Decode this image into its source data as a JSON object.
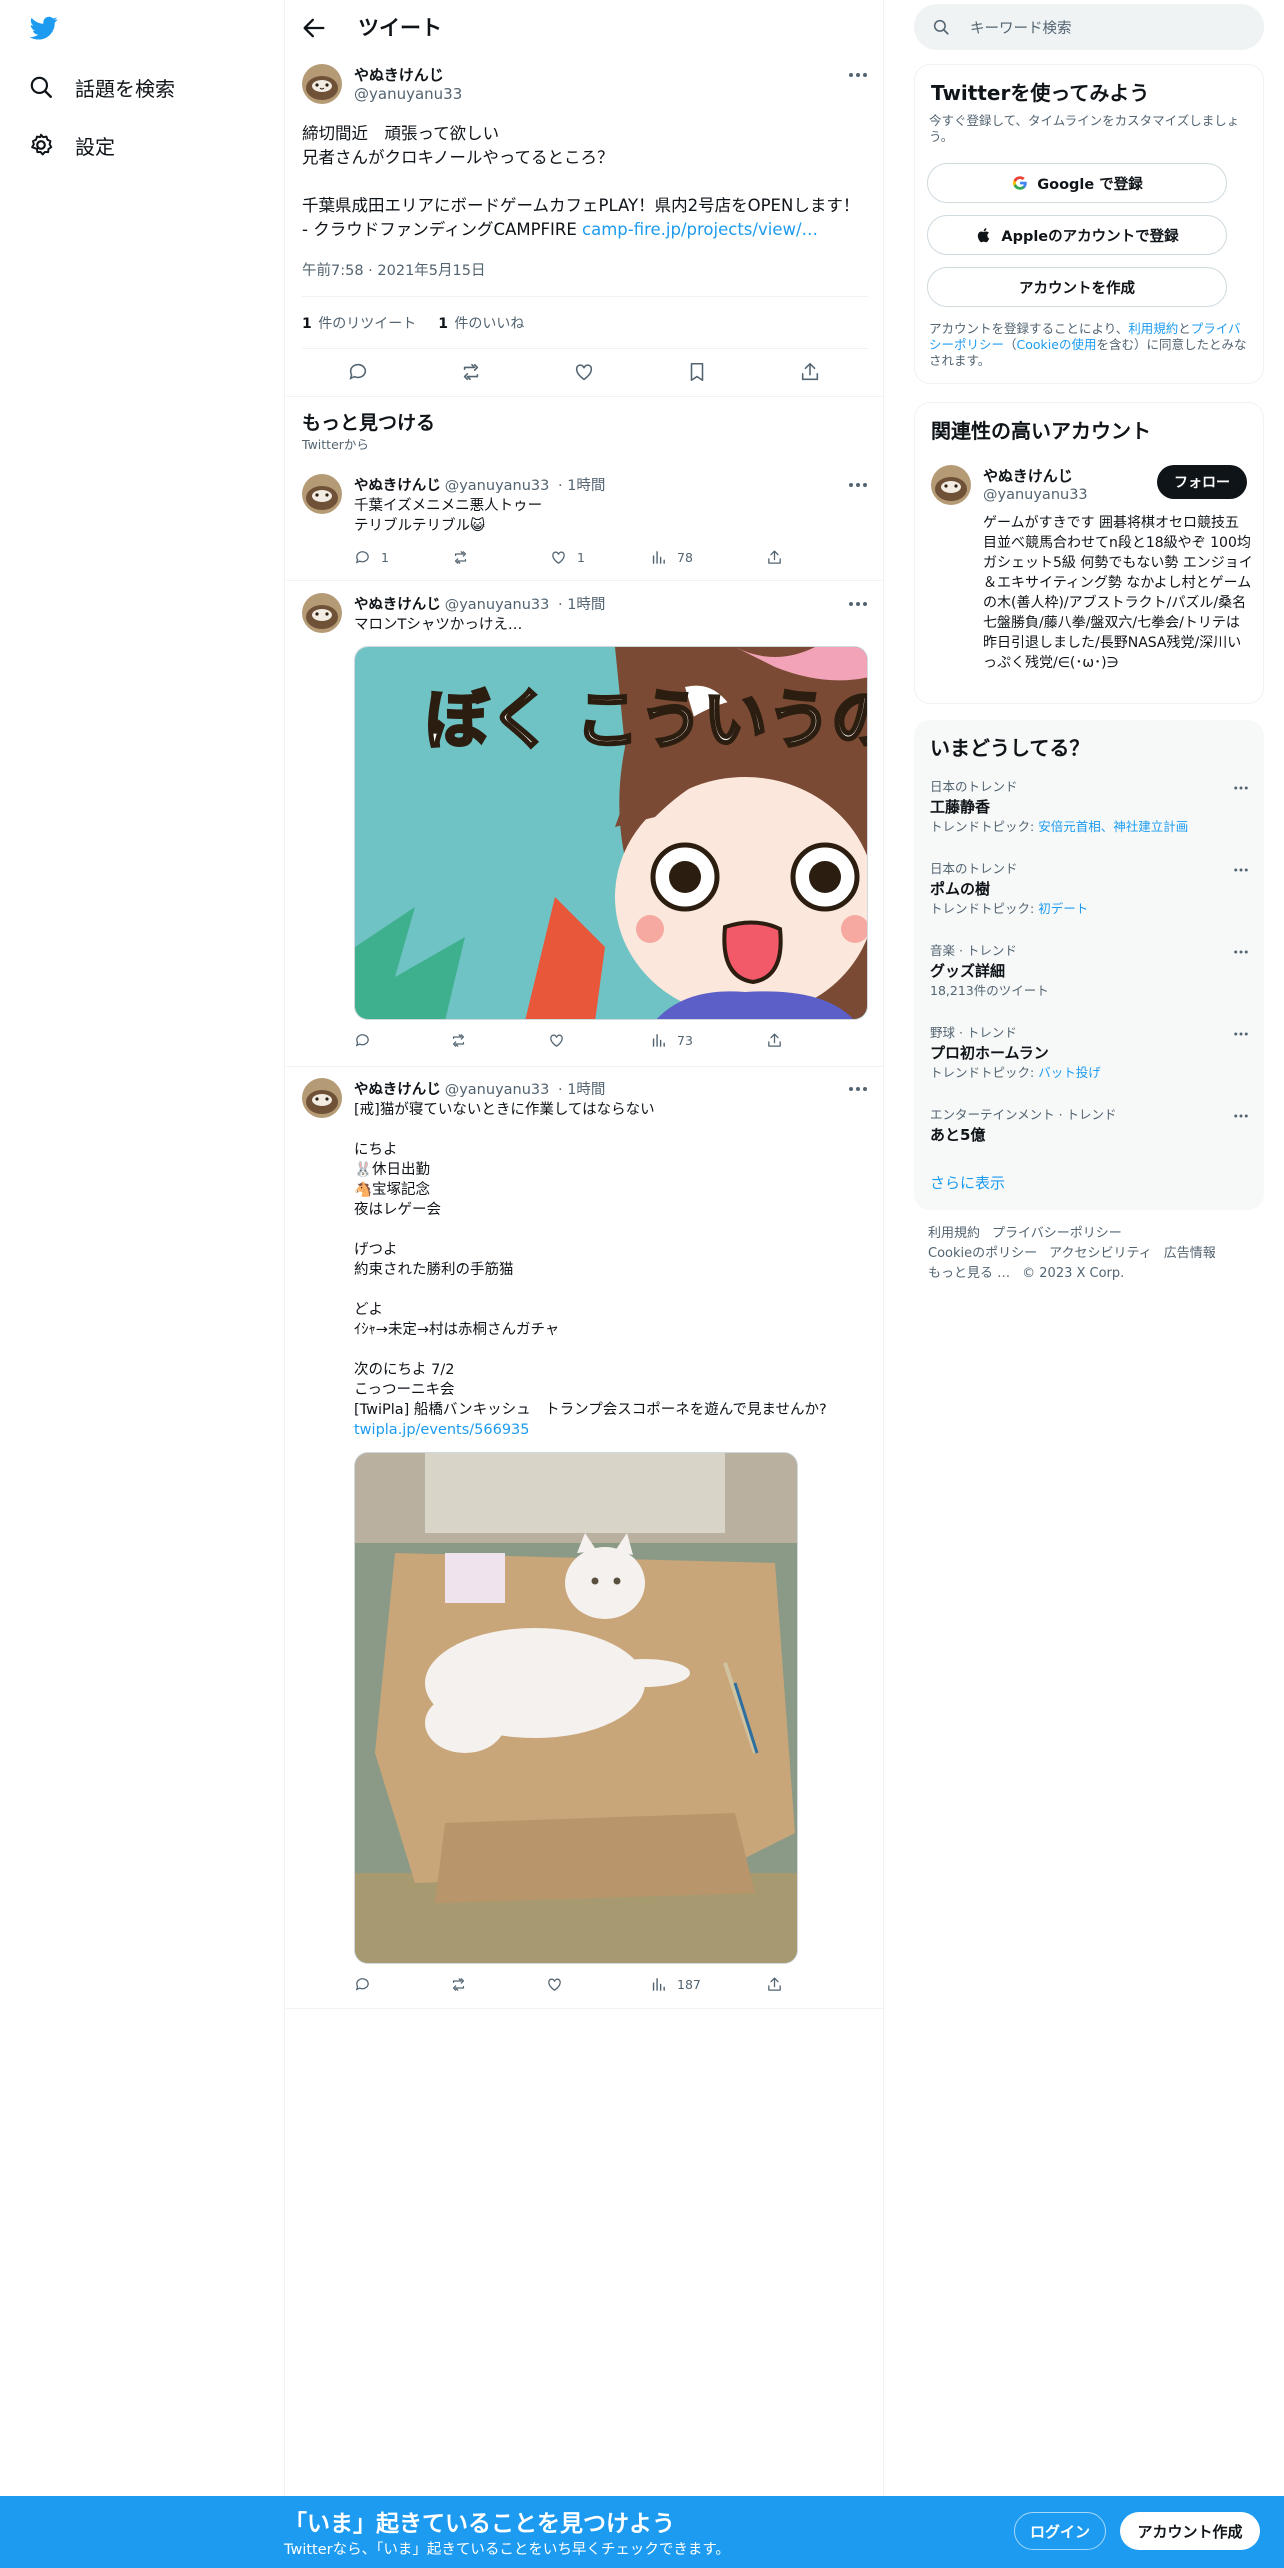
{
  "nav": {
    "explore_label": "話題を検索",
    "settings_label": "設定"
  },
  "header": {
    "title": "ツイート"
  },
  "focused_tweet": {
    "name": "やぬきけんじ",
    "handle": "@yanuyanu33",
    "text_line1": "締切間近　頑張って欲しい",
    "text_line2": "兄者さんがクロキノールやってるところ？",
    "text_line3": "千葉県成田エリアにボードゲームカフェPLAY！県内2号店をOPENします！ - クラウドファンディングCAMPFIRE ",
    "link": "camp-fire.jp/projects/view/…",
    "time": "午前7:58 · 2021年5月15日",
    "retweet_count": "1",
    "retweet_label": "件のリツイート",
    "like_count": "1",
    "like_label": "件のいいね"
  },
  "discover": {
    "title": "もっと見つける",
    "subtitle": "Twitterから"
  },
  "tweets": [
    {
      "name": "やぬきけんじ",
      "handle": "@yanuyanu33",
      "time": "· 1時間",
      "line1": "千葉イズメニメニ悪人トゥー",
      "line2": "テリブルテリブル😺",
      "replies": "1",
      "likes": "1",
      "views": "78"
    },
    {
      "name": "やぬきけんじ",
      "handle": "@yanuyanu33",
      "time": "· 1時間",
      "line1": "マロンTシャツかっけえ…",
      "image_text": "ぼく こういうの すき",
      "views": "73"
    },
    {
      "name": "やぬきけんじ",
      "handle": "@yanuyanu33",
      "time": "· 1時間",
      "body": "[戒]猫が寝ていないときに作業してはならない\n\nにちよ\n🐰休日出勤\n🐴宝塚記念\n夜はレゲー会\n\nげつよ\n約束された勝利の手筋猫\n\nどよ\nｲｼｬ→未定→村は赤桐さんガチャ\n\n次のにちよ 7/2\nこっつーニキ会\n[TwiPla] 船橋バンキッシュ　トランプ会スコポーネを遊んで見ませんか?",
      "link": "twipla.jp/events/566935",
      "views": "187"
    }
  ],
  "search": {
    "placeholder": "キーワード検索"
  },
  "signup_card": {
    "title": "Twitterを使ってみよう",
    "subtitle": "今すぐ登録して、タイムラインをカスタマイズしましょう。",
    "google_label": "Google で登録",
    "apple_label": "Appleのアカウントで登録",
    "create_label": "アカウントを作成",
    "legal_pre": "アカウントを登録することにより、",
    "legal_terms": "利用規約",
    "legal_and": "と",
    "legal_privacy": "プライバシーポリシー",
    "legal_mid": "（",
    "legal_cookie": "Cookieの使用",
    "legal_post": "を含む）に同意したとみなされます。"
  },
  "related": {
    "title": "関連性の高いアカウント",
    "name": "やぬきけんじ",
    "handle": "@yanuyanu33",
    "follow_label": "フォロー",
    "bio": "ゲームがすきです 囲碁将棋オセロ競技五目並べ競馬合わせてn段と18級やぞ 100均ガシェット5級 何勢でもない勢 エンジョイ＆エキサイティング勢 なかよし村とゲームの木(善人枠)/アブストラクト/パズル/桑名七盤勝負/藤八拳/盤双六/七拳会/トリテは昨日引退しました/長野NASA残党/深川いっぷく残党/∈(･ω･)∋"
  },
  "trends": {
    "title": "いまどうしてる？",
    "items": [
      {
        "category": "日本のトレンド",
        "name": "工藤静香",
        "topic_label": "トレンドトピック: ",
        "topics": "安倍元首相、神社建立計画"
      },
      {
        "category": "日本のトレンド",
        "name": "ポムの樹",
        "topic_label": "トレンドトピック: ",
        "topics": "初デート"
      },
      {
        "category": "音楽 · トレンド",
        "name": "グッズ詳細",
        "count": "18,213件のツイート"
      },
      {
        "category": "野球 · トレンド",
        "name": "プロ初ホームラン",
        "topic_label": "トレンドトピック: ",
        "topics": "バット投げ"
      },
      {
        "category": "エンターテインメント · トレンド",
        "name": "あと5億"
      }
    ],
    "show_more": "さらに表示"
  },
  "footer": {
    "links": [
      "利用規約",
      "プライバシーポリシー",
      "Cookieのポリシー",
      "アクセシビリティ",
      "広告情報",
      "もっと見る …"
    ],
    "copyright": "© 2023 X Corp."
  },
  "bottom": {
    "title": "「いま」起きていることを見つけよう",
    "subtitle": "Twitterなら、「いま」起きていることをいち早くチェックできます。",
    "login": "ログイン",
    "signup": "アカウント作成"
  },
  "colors": {
    "accent": "#1d9bf0",
    "text": "#0f1419",
    "muted": "#536471"
  }
}
